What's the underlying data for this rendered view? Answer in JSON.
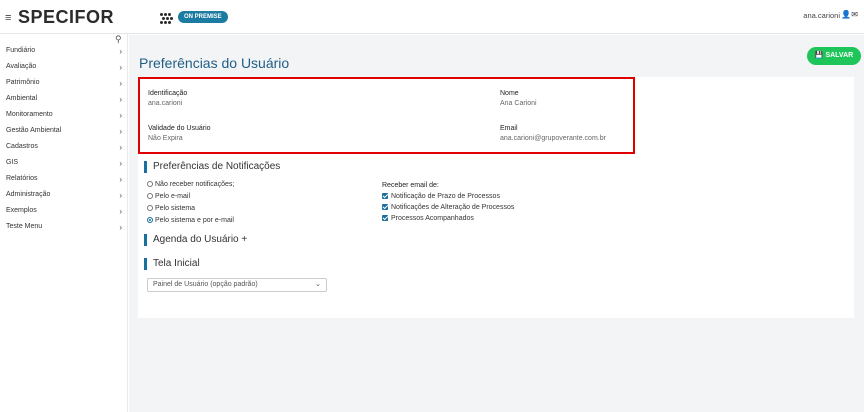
{
  "header": {
    "menu_icon": "hamburger-icon",
    "logo_text": "SPECIFOR",
    "badge": "ON PREMISE",
    "user_name": "ana.carioni",
    "user_icon": "person-icon",
    "mail_icon": "envelope-icon"
  },
  "sidebar": {
    "search_icon": "search-icon",
    "items": [
      {
        "label": "Fundiário"
      },
      {
        "label": "Avaliação"
      },
      {
        "label": "Patrimônio"
      },
      {
        "label": "Ambiental"
      },
      {
        "label": "Monitoramento"
      },
      {
        "label": "Gestão Ambiental"
      },
      {
        "label": "Cadastros"
      },
      {
        "label": "GIS"
      },
      {
        "label": "Relatórios"
      },
      {
        "label": "Administração"
      },
      {
        "label": "Exemplos"
      },
      {
        "label": "Teste Menu"
      }
    ]
  },
  "main": {
    "title": "Preferências do Usuário",
    "save_label": "SALVAR",
    "identification_label": "Identificação",
    "identification_value": "ana.carioni",
    "name_label": "Nome",
    "name_value": "Ana Carioni",
    "validity_label": "Validade do Usuário",
    "validity_value": "Não Expira",
    "email_label": "Email",
    "email_value": "ana.carioni@grupoverante.com.br",
    "notifications_title": "Preferências de Notificações",
    "radio_options": [
      {
        "label": "Não receber notificações;",
        "checked": false
      },
      {
        "label": "Pelo e-mail",
        "checked": false
      },
      {
        "label": "Pelo sistema",
        "checked": false
      },
      {
        "label": "Pelo sistema e por e-mail",
        "checked": true
      }
    ],
    "email_receive_label": "Receber email de:",
    "email_checks": [
      {
        "label": "Notificação de Prazo de Processos",
        "checked": true
      },
      {
        "label": "Notificações de Alteração de Processos",
        "checked": true
      },
      {
        "label": "Processos Acompanhados",
        "checked": true
      }
    ],
    "agenda_title": "Agenda do Usuário",
    "agenda_add": "+",
    "home_title": "Tela Inicial",
    "home_select_value": "Painel de Usuário (opção padrão)"
  },
  "colors": {
    "accent": "#1b6fa0",
    "save_button": "#1ec65a",
    "highlight_border": "#e00000"
  }
}
